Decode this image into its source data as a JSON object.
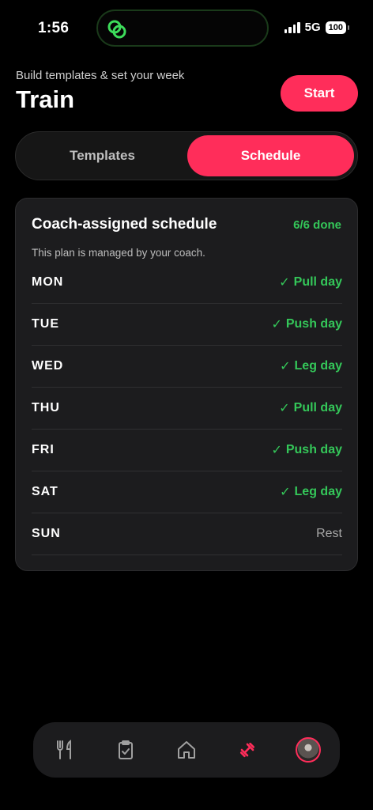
{
  "status_bar": {
    "time": "1:56",
    "network": "5G",
    "battery": "100"
  },
  "header": {
    "subtitle": "Build templates & set your week",
    "title": "Train",
    "start_label": "Start"
  },
  "segmented": {
    "options": [
      "Templates",
      "Schedule"
    ],
    "selected": "Schedule"
  },
  "schedule": {
    "title": "Coach-assigned schedule",
    "progress": "6/6 done",
    "note": "This plan is managed by your coach.",
    "days": [
      {
        "day": "MON",
        "plan": "Pull day",
        "done": true
      },
      {
        "day": "TUE",
        "plan": "Push day",
        "done": true
      },
      {
        "day": "WED",
        "plan": "Leg day",
        "done": true
      },
      {
        "day": "THU",
        "plan": "Pull day",
        "done": true
      },
      {
        "day": "FRI",
        "plan": "Push day",
        "done": true
      },
      {
        "day": "SAT",
        "plan": "Leg day",
        "done": true
      },
      {
        "day": "SUN",
        "plan": "Rest",
        "done": false
      }
    ]
  },
  "tabbar": {
    "items": [
      "fork-knife-icon",
      "clipboard-check-icon",
      "home-icon",
      "dumbbell-icon",
      "profile-avatar"
    ],
    "active": "dumbbell-icon"
  },
  "colors": {
    "accent": "#ff2d5a",
    "success": "#34c759",
    "card": "#1c1c1e",
    "background": "#000000"
  }
}
